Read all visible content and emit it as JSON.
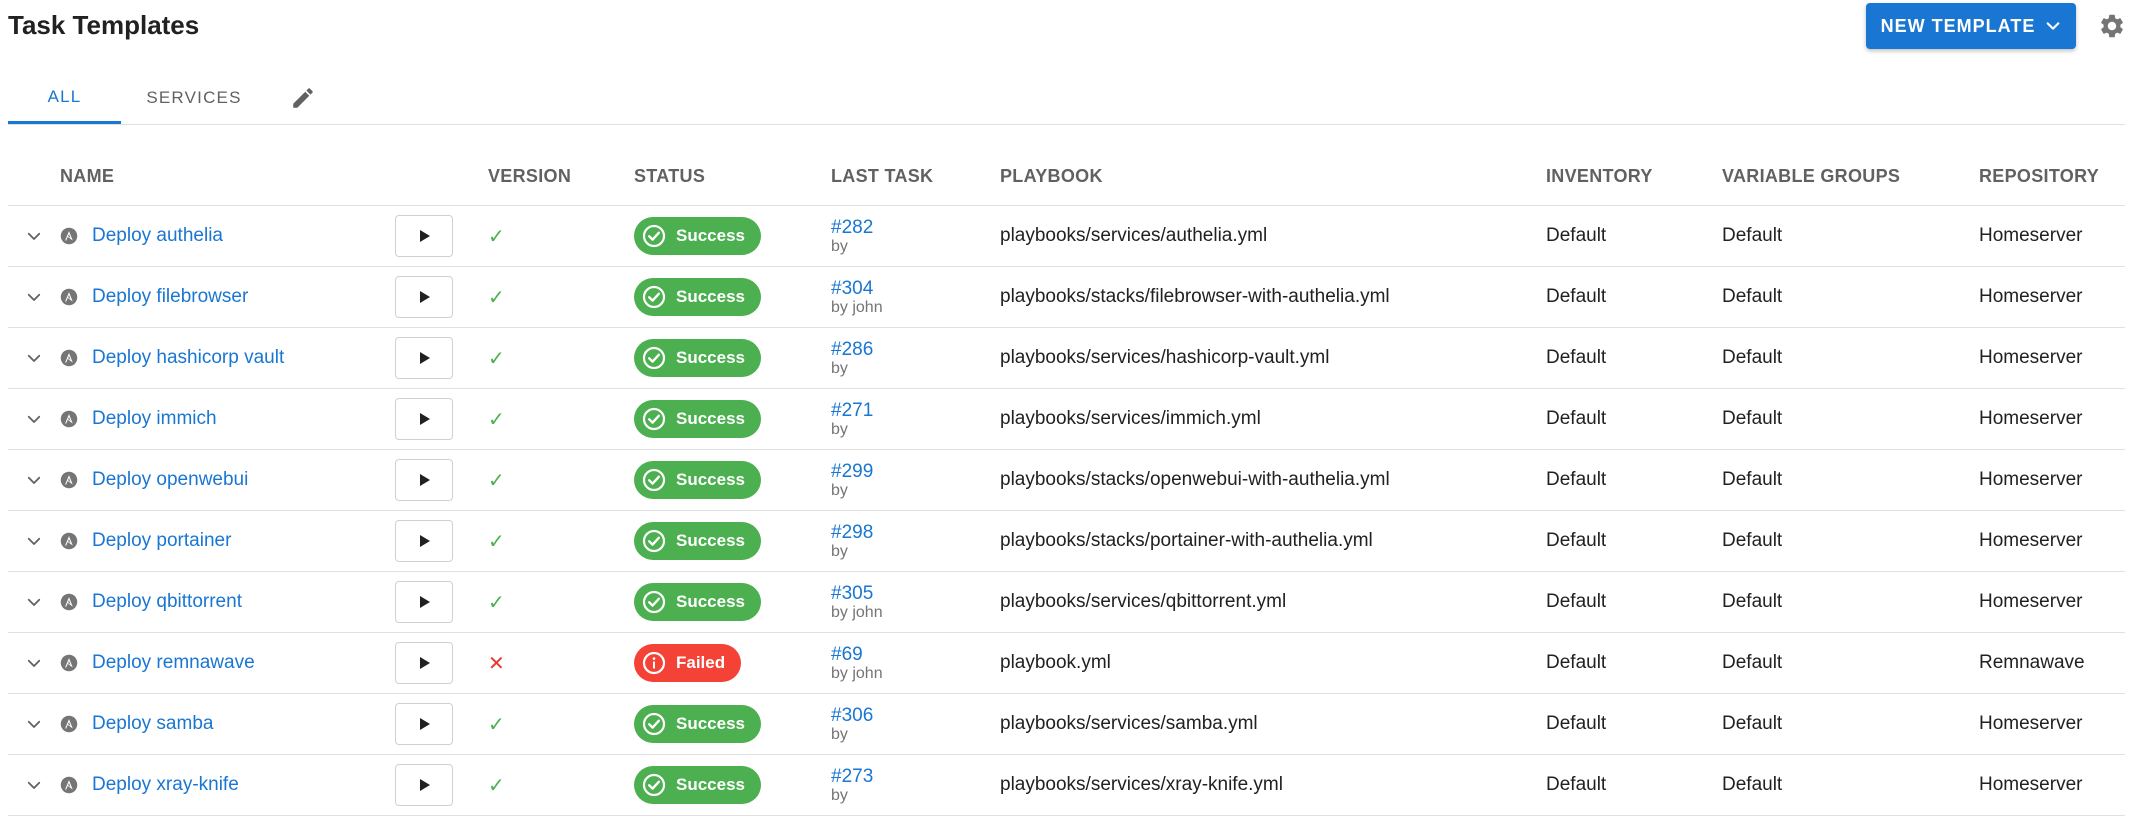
{
  "page": {
    "title": "Task Templates",
    "new_template_label": "NEW TEMPLATE"
  },
  "colors": {
    "accent": "#1976d2",
    "success": "#4caf50",
    "failed": "#f44336"
  },
  "icons": {
    "settings": "gear-icon",
    "dropdown": "chevron-down-icon",
    "edit": "pencil-icon",
    "expand": "chevron-down-icon",
    "app": "ansible-icon",
    "run": "play-icon",
    "success": "check-circle-icon",
    "failed": "info-circle-icon"
  },
  "tabs": [
    {
      "label": "ALL",
      "active": true
    },
    {
      "label": "SERVICES",
      "active": false
    }
  ],
  "table": {
    "columns": [
      "NAME",
      "VERSION",
      "STATUS",
      "LAST TASK",
      "PLAYBOOK",
      "INVENTORY",
      "VARIABLE GROUPS",
      "REPOSITORY"
    ],
    "rows": [
      {
        "name": "Deploy authelia",
        "version_ok": true,
        "status": "Success",
        "task": "#282",
        "by": "by",
        "playbook": "playbooks/services/authelia.yml",
        "inventory": "Default",
        "variable_groups": "Default",
        "repository": "Homeserver"
      },
      {
        "name": "Deploy filebrowser",
        "version_ok": true,
        "status": "Success",
        "task": "#304",
        "by": "by john",
        "playbook": "playbooks/stacks/filebrowser-with-authelia.yml",
        "inventory": "Default",
        "variable_groups": "Default",
        "repository": "Homeserver"
      },
      {
        "name": "Deploy hashicorp vault",
        "version_ok": true,
        "status": "Success",
        "task": "#286",
        "by": "by",
        "playbook": "playbooks/services/hashicorp-vault.yml",
        "inventory": "Default",
        "variable_groups": "Default",
        "repository": "Homeserver"
      },
      {
        "name": "Deploy immich",
        "version_ok": true,
        "status": "Success",
        "task": "#271",
        "by": "by",
        "playbook": "playbooks/services/immich.yml",
        "inventory": "Default",
        "variable_groups": "Default",
        "repository": "Homeserver"
      },
      {
        "name": "Deploy openwebui",
        "version_ok": true,
        "status": "Success",
        "task": "#299",
        "by": "by",
        "playbook": "playbooks/stacks/openwebui-with-authelia.yml",
        "inventory": "Default",
        "variable_groups": "Default",
        "repository": "Homeserver"
      },
      {
        "name": "Deploy portainer",
        "version_ok": true,
        "status": "Success",
        "task": "#298",
        "by": "by",
        "playbook": "playbooks/stacks/portainer-with-authelia.yml",
        "inventory": "Default",
        "variable_groups": "Default",
        "repository": "Homeserver"
      },
      {
        "name": "Deploy qbittorrent",
        "version_ok": true,
        "status": "Success",
        "task": "#305",
        "by": "by john",
        "playbook": "playbooks/services/qbittorrent.yml",
        "inventory": "Default",
        "variable_groups": "Default",
        "repository": "Homeserver"
      },
      {
        "name": "Deploy remnawave",
        "version_ok": false,
        "status": "Failed",
        "task": "#69",
        "by": "by john",
        "playbook": "playbook.yml",
        "inventory": "Default",
        "variable_groups": "Default",
        "repository": "Remnawave"
      },
      {
        "name": "Deploy samba",
        "version_ok": true,
        "status": "Success",
        "task": "#306",
        "by": "by",
        "playbook": "playbooks/services/samba.yml",
        "inventory": "Default",
        "variable_groups": "Default",
        "repository": "Homeserver"
      },
      {
        "name": "Deploy xray-knife",
        "version_ok": true,
        "status": "Success",
        "task": "#273",
        "by": "by",
        "playbook": "playbooks/services/xray-knife.yml",
        "inventory": "Default",
        "variable_groups": "Default",
        "repository": "Homeserver"
      }
    ]
  }
}
